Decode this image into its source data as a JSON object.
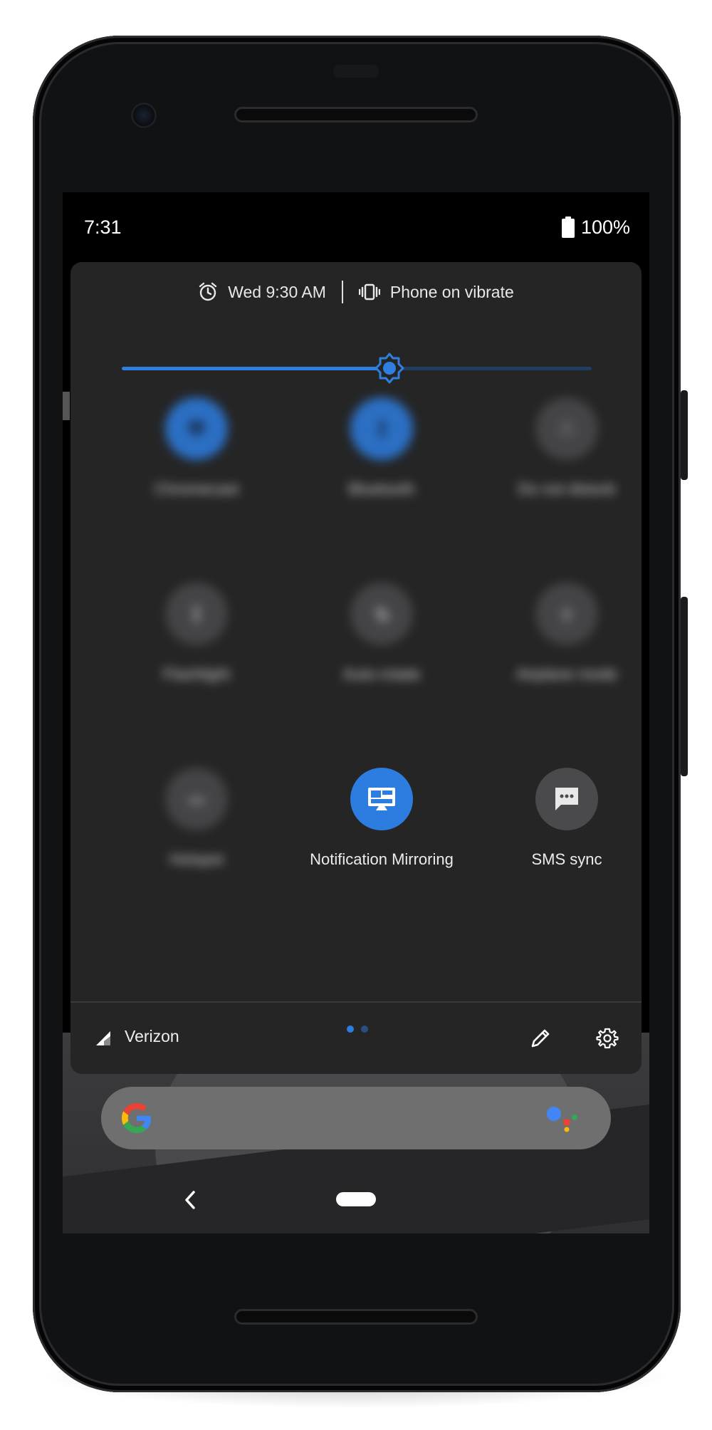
{
  "status_bar": {
    "time": "7:31",
    "battery_percent": "100%",
    "battery_icon": "battery-full-icon"
  },
  "quick_settings": {
    "header": {
      "alarm_icon": "alarm-clock-icon",
      "alarm_text": "Wed 9:30 AM",
      "vibrate_icon": "vibrate-icon",
      "ringer_text": "Phone on vibrate"
    },
    "brightness": {
      "level": 0.57,
      "accent": "#2f7fe0"
    },
    "tiles": [
      {
        "label": "Chromecast",
        "icon": "cast-icon",
        "state": "on",
        "blurred": true
      },
      {
        "label": "Bluetooth",
        "icon": "bluetooth-icon",
        "state": "on",
        "blurred": true
      },
      {
        "label": "Do not disturb",
        "icon": "do-not-disturb-icon",
        "state": "off",
        "blurred": true
      },
      {
        "label": "Flashlight",
        "icon": "flashlight-icon",
        "state": "off",
        "blurred": true
      },
      {
        "label": "Auto-rotate",
        "icon": "rotate-icon",
        "state": "off",
        "blurred": true
      },
      {
        "label": "Airplane mode",
        "icon": "airplane-icon",
        "state": "off",
        "blurred": true
      },
      {
        "label": "Hotspot",
        "icon": "hotspot-icon",
        "state": "off",
        "blurred": true
      },
      {
        "label": "Notification Mirroring",
        "icon": "monitor-icon",
        "state": "on",
        "blurred": false
      },
      {
        "label": "SMS sync",
        "icon": "chat-bubble-icon",
        "state": "off",
        "blurred": false
      }
    ],
    "page_indicator": {
      "pages": 2,
      "current": 1
    },
    "footer": {
      "carrier": "Verizon",
      "signal_icon": "cell-signal-icon",
      "edit_icon": "pencil-icon",
      "settings_icon": "gear-icon"
    }
  },
  "home": {
    "search_logo": "google-g-icon",
    "assistant_icon": "google-assistant-icon"
  },
  "navigation": {
    "back_icon": "back-chevron-icon",
    "home_icon": "home-pill-icon"
  },
  "colors": {
    "accent": "#2d7de0",
    "panel": "#252526",
    "tile_off": "#4a4a4c"
  }
}
